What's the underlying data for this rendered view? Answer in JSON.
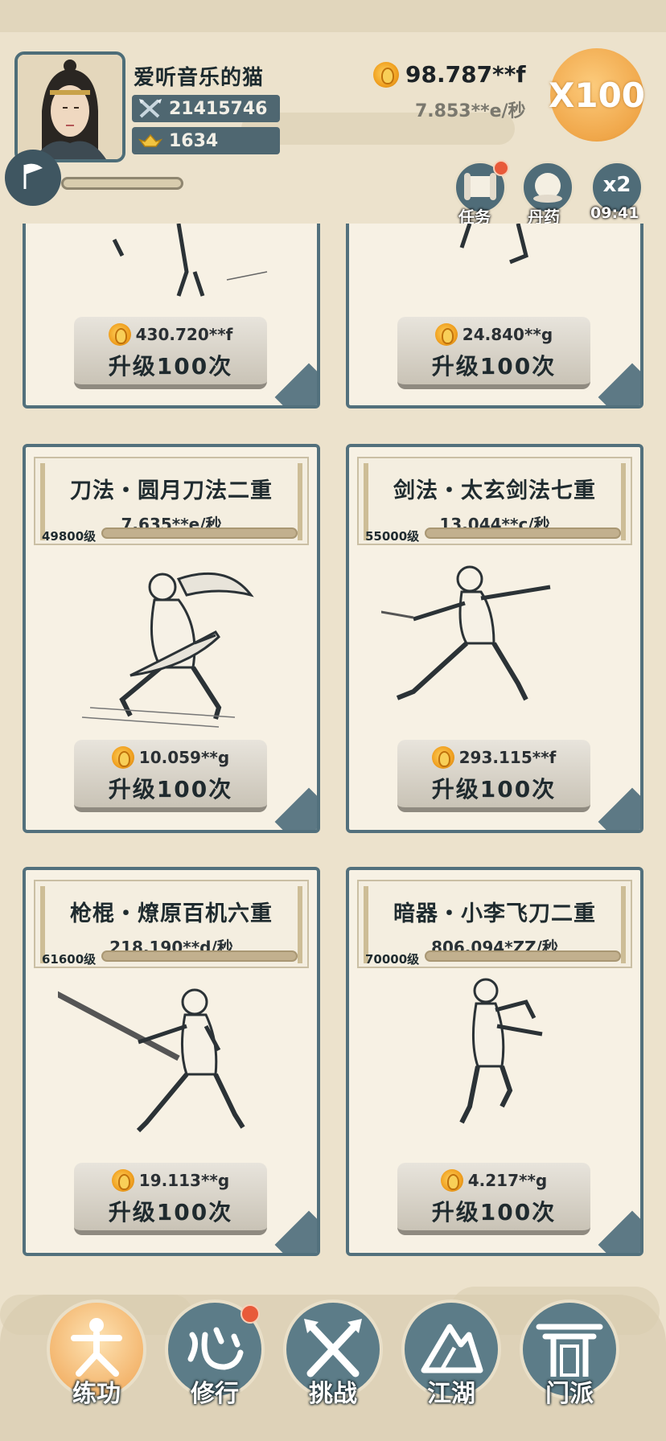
{
  "player": {
    "name": "爱听音乐的猫",
    "power": "21415746",
    "gold_ingots": "1634"
  },
  "currency": {
    "amount": "98.787**f",
    "rate": "7.853**e/秒",
    "multiplier": "X100"
  },
  "quick_buttons": {
    "task_label": "任务",
    "pill_label": "丹药",
    "x2_label": "x2",
    "x2_timer": "09:41"
  },
  "top_cards": [
    {
      "cost": "430.720**f",
      "upgrade_label": "升级100次"
    },
    {
      "cost": "24.840**g",
      "upgrade_label": "升级100次"
    }
  ],
  "cards": [
    {
      "name": "刀法・圆月刀法二重",
      "rate": "7.635**e/秒",
      "level": "49800级",
      "cost": "10.059**g",
      "upgrade_label": "升级100次"
    },
    {
      "name": "剑法・太玄剑法七重",
      "rate": "13.044**c/秒",
      "level": "55000级",
      "cost": "293.115**f",
      "upgrade_label": "升级100次"
    },
    {
      "name": "枪棍・燎原百机六重",
      "rate": "218.190**d/秒",
      "level": "61600级",
      "cost": "19.113**g",
      "upgrade_label": "升级100次"
    },
    {
      "name": "暗器・小李飞刀二重",
      "rate": "806.094*ZZ/秒",
      "level": "70000级",
      "cost": "4.217**g",
      "upgrade_label": "升级100次"
    }
  ],
  "nav": [
    {
      "label": "练功",
      "active": true
    },
    {
      "label": "修行",
      "active": false
    },
    {
      "label": "挑战",
      "active": false
    },
    {
      "label": "江湖",
      "active": false
    },
    {
      "label": "门派",
      "active": false
    }
  ],
  "colors": {
    "background": "#ece2cc",
    "card_border": "#52707c",
    "nav_active": "#f3b36a",
    "notification": "#e85a3a"
  }
}
